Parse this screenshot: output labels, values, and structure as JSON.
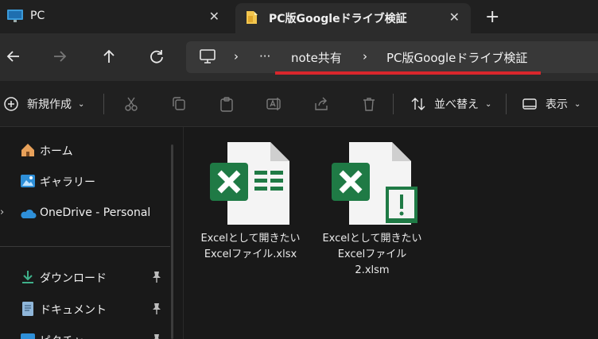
{
  "tabs": [
    {
      "label": "PC",
      "close": "✕"
    },
    {
      "label": "PC版Googleドライブ検証",
      "close": "✕"
    }
  ],
  "newtab": "+",
  "breadcrumb": {
    "overflow": "···",
    "sep": "›",
    "items": [
      "note共有",
      "PC版Googleドライブ検証"
    ]
  },
  "toolbar": {
    "new_label": "新規作成",
    "sort_label": "並べ替え",
    "view_label": "表示",
    "more": "···"
  },
  "sidebar": {
    "items": [
      {
        "label": "ホーム"
      },
      {
        "label": "ギャラリー"
      },
      {
        "label": "OneDrive - Personal"
      },
      {
        "label": "ダウンロード"
      },
      {
        "label": "ドキュメント"
      },
      {
        "label": "ピクチャ"
      }
    ]
  },
  "files": [
    {
      "name_line1": "Excelとして開きたい",
      "name_line2": "Excelファイル.xlsx",
      "name_line3": ""
    },
    {
      "name_line1": "Excelとして開きたい",
      "name_line2": "Excelファイル",
      "name_line3": "2.xlsm"
    }
  ],
  "colors": {
    "excel_green": "#1f7a45",
    "accent_red": "#d9262c",
    "onedrive_blue": "#2e8fd8"
  }
}
